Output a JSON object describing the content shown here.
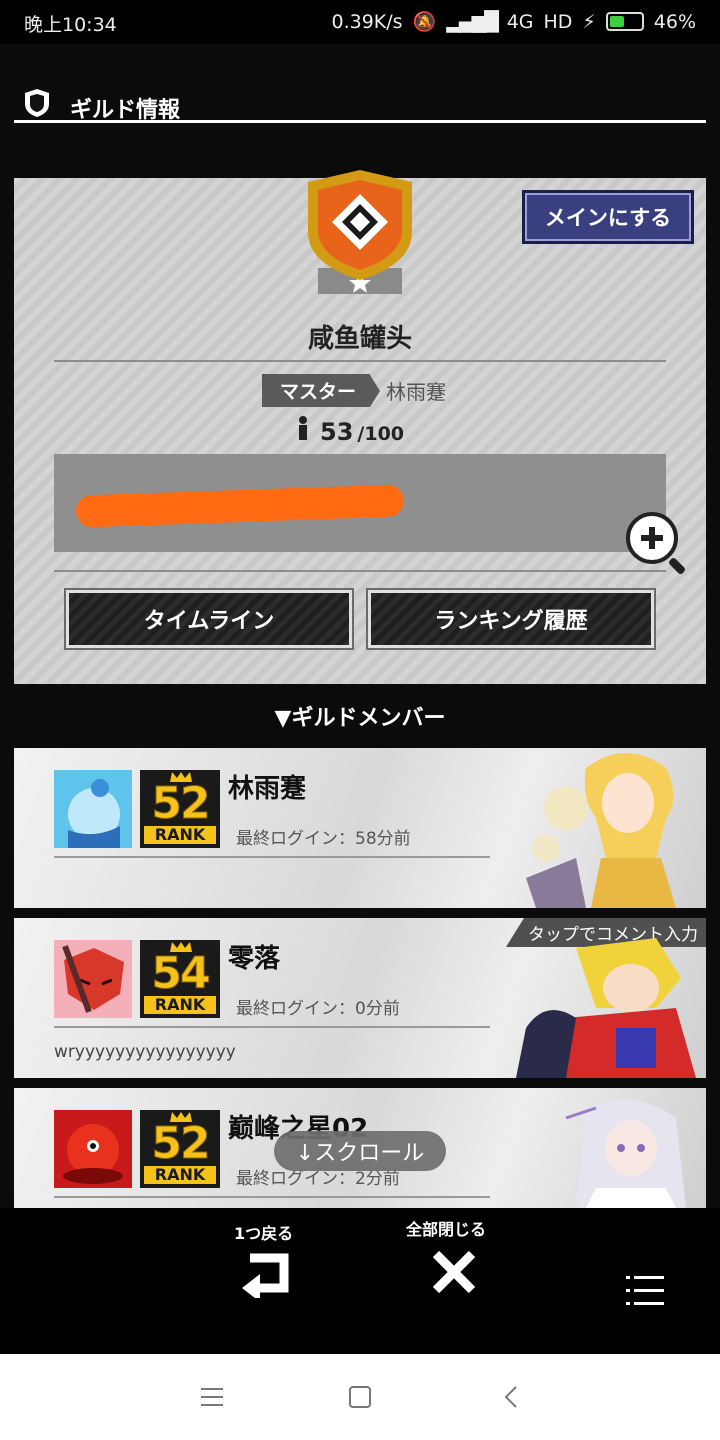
{
  "status_bar": {
    "time": "晚上10:34",
    "speed": "0.39K/s",
    "network": "4G",
    "hd": "HD",
    "battery": "46%"
  },
  "header": {
    "title": "ギルド情報"
  },
  "guild": {
    "make_main_button": "メインにする",
    "name": "咸鱼罐头",
    "master_label": "マスター",
    "master_name": "林雨蹇",
    "member_count": "53",
    "member_max": "/100",
    "timeline_button": "タイムライン",
    "ranking_button": "ランキング履歴"
  },
  "members_section": {
    "title": "▼ギルドメンバー"
  },
  "members": [
    {
      "name": "林雨蹇",
      "rank": "52",
      "rank_label": "RANK",
      "last_login": "最終ログイン：58分前",
      "comment": ""
    },
    {
      "name": "零落",
      "rank": "54",
      "rank_label": "RANK",
      "last_login": "最終ログイン：0分前",
      "comment": "wryyyyyyyyyyyyyyyy",
      "hint": "タップでコメント入力"
    },
    {
      "name": "巅峰之星02",
      "rank": "52",
      "rank_label": "RANK",
      "last_login": "最終ログイン：2分前",
      "comment": ""
    }
  ],
  "scroll_hint": "↓スクロール",
  "bottom_bar": {
    "back_label": "1つ戻る",
    "close_all_label": "全部閉じる"
  },
  "colors": {
    "accent_orange": "#e8641a",
    "rank_gold": "#f4c21a",
    "main_button": "#3a3f80"
  }
}
